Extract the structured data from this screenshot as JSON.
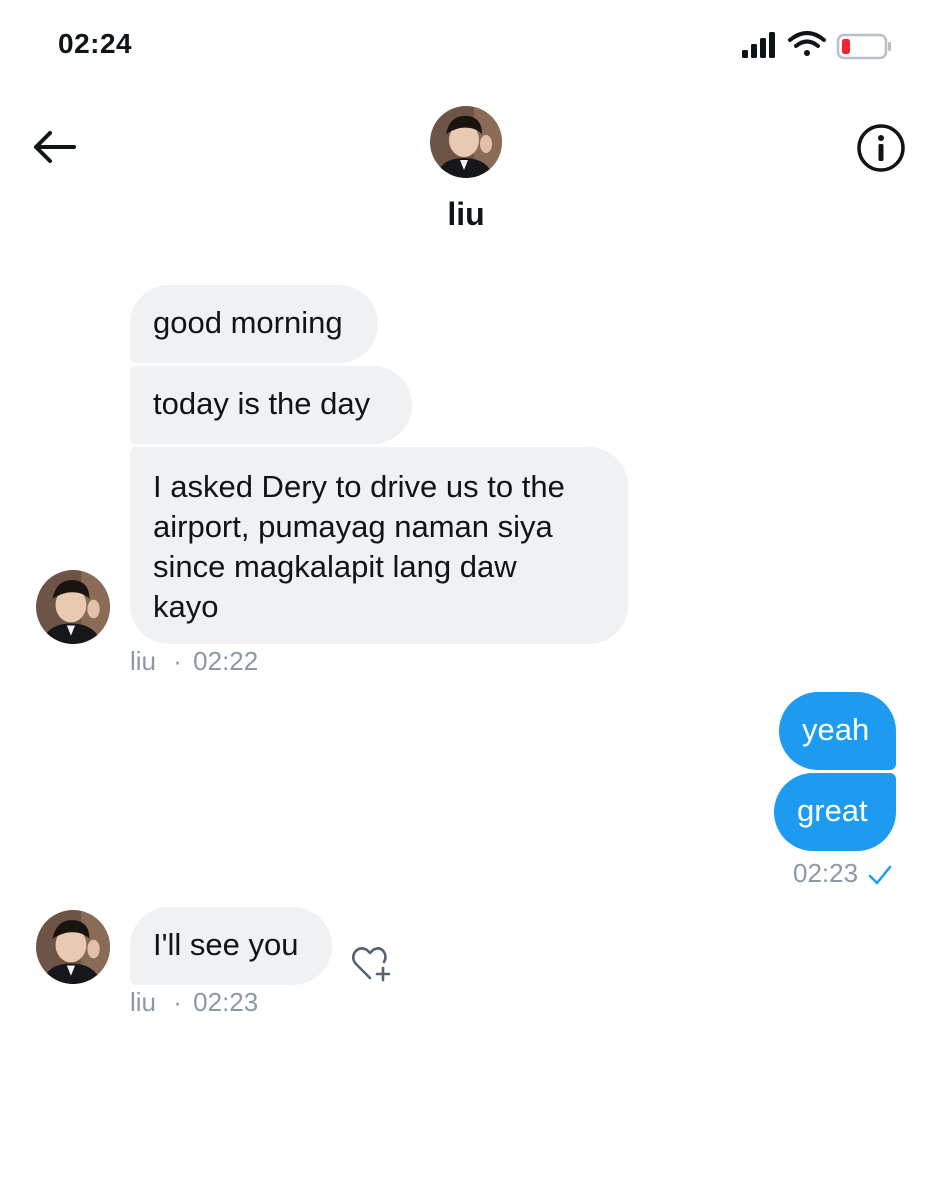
{
  "status": {
    "time": "02:24"
  },
  "conversation": {
    "contact_name": "liu",
    "messages": [
      {
        "sender": "liu",
        "text": "good morning"
      },
      {
        "sender": "liu",
        "text": "today is the day"
      },
      {
        "sender": "liu",
        "lines": [
          "I asked Dery to drive us to the",
          "airport, pumayag naman siya",
          "since magkalapit lang daw",
          "kayo"
        ]
      },
      {
        "sender": "me",
        "text": "yeah"
      },
      {
        "sender": "me",
        "text": "great"
      },
      {
        "sender": "liu",
        "text": "I'll see you"
      }
    ],
    "meta": {
      "group1_name": "liu",
      "group1_time": "02:22",
      "sent_time": "02:23",
      "group3_name": "liu",
      "group3_time": "02:23"
    }
  },
  "colors": {
    "outgoing": "#1d9bf0",
    "incoming": "#eff1f3",
    "meta": "#8b98a5",
    "battery_low": "#f4212e"
  },
  "icons": [
    "signal-icon",
    "wifi-icon",
    "battery-icon",
    "back-arrow-icon",
    "info-icon",
    "heart-add-icon",
    "sent-check-icon"
  ]
}
